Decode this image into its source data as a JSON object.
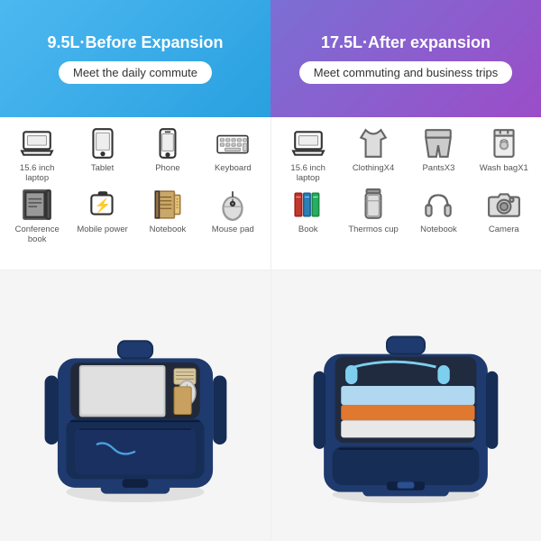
{
  "banners": {
    "left": {
      "title": "9.5L·Before Expansion",
      "subtitle": "Meet the daily commute"
    },
    "right": {
      "title": "17.5L·After expansion",
      "subtitle": "Meet commuting and business trips"
    }
  },
  "icons_left": {
    "row1": [
      {
        "label": "15.6 inch laptop",
        "icon": "laptop"
      },
      {
        "label": "Tablet",
        "icon": "tablet"
      },
      {
        "label": "Phone",
        "icon": "phone"
      },
      {
        "label": "Keyboard",
        "icon": "keyboard"
      }
    ],
    "row2": [
      {
        "label": "Conference book",
        "icon": "book"
      },
      {
        "label": "Mobile power",
        "icon": "power"
      },
      {
        "label": "Notebook",
        "icon": "notebook"
      },
      {
        "label": "Mouse pad",
        "icon": "mouse"
      }
    ]
  },
  "icons_right": {
    "row1": [
      {
        "label": "15.6 inch laptop",
        "icon": "laptop"
      },
      {
        "label": "ClothingX4",
        "icon": "clothing"
      },
      {
        "label": "PantsX3",
        "icon": "pants"
      },
      {
        "label": "Wash bagX1",
        "icon": "washbag"
      }
    ],
    "row2": [
      {
        "label": "Book",
        "icon": "books"
      },
      {
        "label": "Thermos cup",
        "icon": "thermos"
      },
      {
        "label": "Notebook",
        "icon": "headphones"
      },
      {
        "label": "Camera",
        "icon": "camera"
      }
    ]
  }
}
